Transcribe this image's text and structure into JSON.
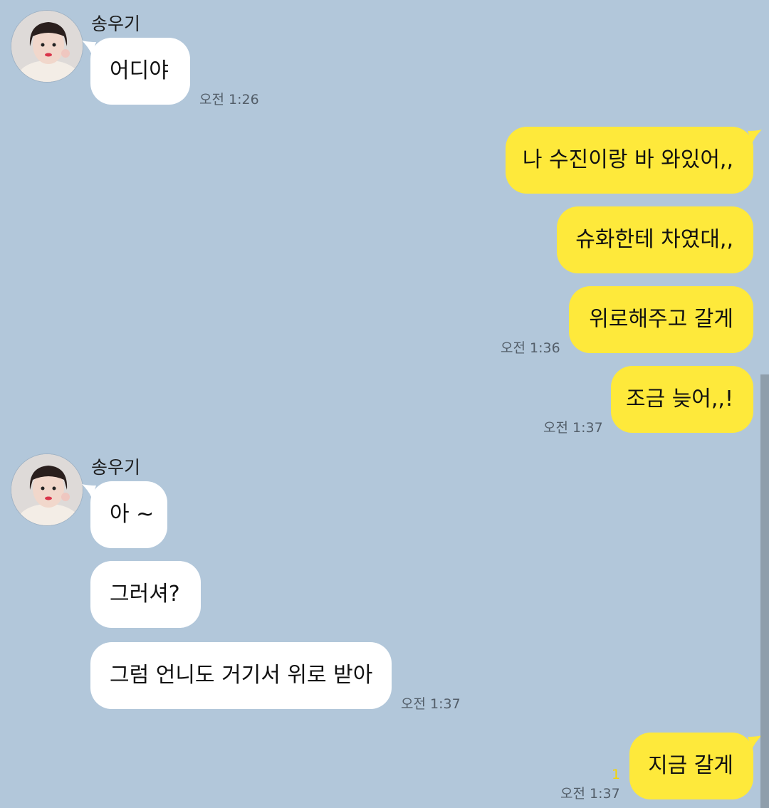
{
  "sender_name": "송우기",
  "messages": {
    "m1": {
      "text": "어디야",
      "time": "오전 1:26"
    },
    "m2": {
      "text": "나 수진이랑 바 와있어,,"
    },
    "m3": {
      "text": "슈화한테 차였대,,"
    },
    "m4": {
      "text": "위로해주고 갈게",
      "time": "오전 1:36"
    },
    "m5": {
      "text": "조금 늦어,,!",
      "time": "오전 1:37"
    },
    "m6": {
      "text": "아 ~"
    },
    "m7": {
      "text": "그러셔?"
    },
    "m8": {
      "text": "그럼 언니도 거기서 위로 받아",
      "time": "오전 1:37"
    },
    "m9": {
      "text": "지금 갈게",
      "time": "오전 1:37",
      "unread": "1"
    }
  },
  "colors": {
    "background": "#b2c7da",
    "incoming_bubble": "#ffffff",
    "outgoing_bubble": "#fee93b",
    "unread_count": "#f5d400"
  },
  "icons": {
    "avatar": "profile-photo"
  }
}
